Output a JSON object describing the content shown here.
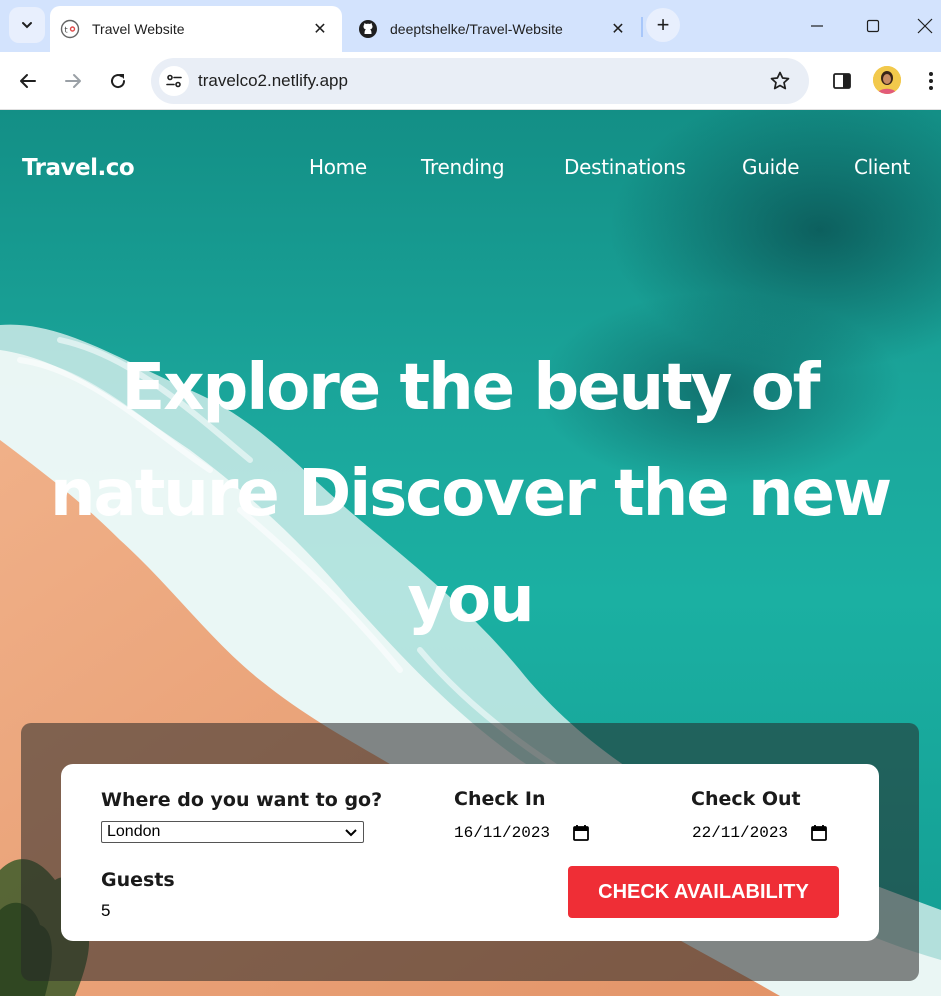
{
  "browser": {
    "tabs": [
      {
        "title": "Travel Website",
        "active": true
      },
      {
        "title": "deeptshelke/Travel-Website",
        "active": false
      }
    ],
    "url": "travelco2.netlify.app"
  },
  "nav": {
    "logo": "Travel.co",
    "items": [
      "Home",
      "Trending",
      "Destinations",
      "Guide",
      "Client"
    ]
  },
  "hero": {
    "line1": "Explore the beuty of",
    "line2": "nature Discover the new",
    "line3": "you"
  },
  "booking": {
    "destination_label": "Where do you want to go?",
    "destination_value": "London",
    "checkin_label": "Check In",
    "checkin_value": "16/11/2023",
    "checkout_label": "Check Out",
    "checkout_value": "22/11/2023",
    "guests_label": "Guests",
    "guests_value": "5",
    "button_label": "CHECK AVAILABILITY"
  },
  "colors": {
    "accent_button": "#ef2e36",
    "sea": "#1ba79c",
    "sand": "#e9a27a",
    "tabbar": "#d3e3fd"
  }
}
